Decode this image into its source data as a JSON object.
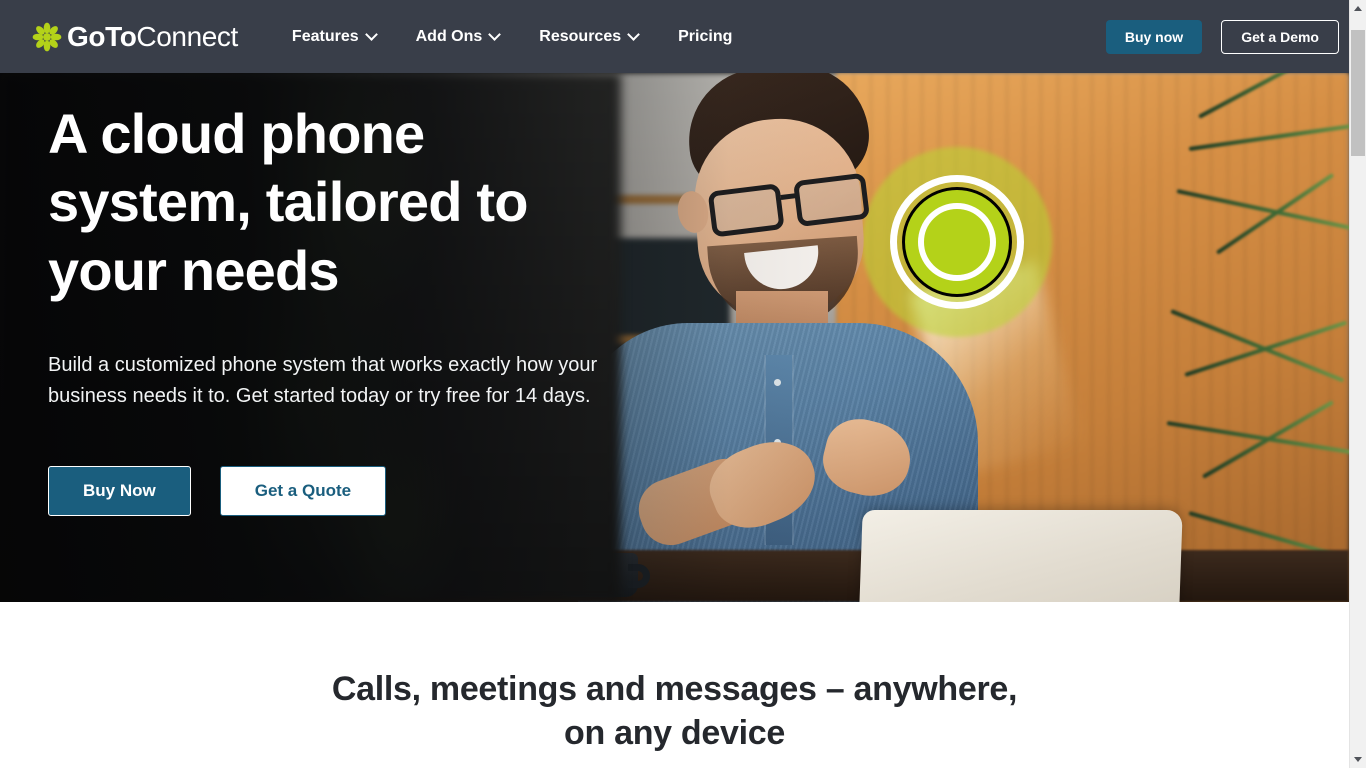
{
  "brand": {
    "logo_bold": "GoTo",
    "logo_light": "Connect",
    "logo_icon": "asterisk-flower-icon",
    "accent_green": "#b4d219",
    "accent_teal": "#1a5e7e",
    "nav_background": "#393e49"
  },
  "nav": {
    "items": [
      {
        "label": "Features",
        "has_dropdown": true
      },
      {
        "label": "Add Ons",
        "has_dropdown": true
      },
      {
        "label": "Resources",
        "has_dropdown": true
      },
      {
        "label": "Pricing",
        "has_dropdown": false
      }
    ],
    "buy_now": "Buy now",
    "get_demo": "Get a Demo"
  },
  "hero": {
    "title_line1": "A cloud phone",
    "title_line2": "system, tailored to",
    "title_line3": "your needs",
    "subtitle": "Build a customized phone system that works exactly how your business needs it to. Get started today or try free for 14 days.",
    "cta_primary": "Buy Now",
    "cta_secondary": "Get a Quote"
  },
  "section2": {
    "heading_line1": "Calls, meetings and messages – anywhere,",
    "heading_line2": "on any device"
  },
  "scrollbar": {
    "up_arrow": "scroll-up-arrow",
    "down_arrow": "scroll-down-arrow"
  }
}
